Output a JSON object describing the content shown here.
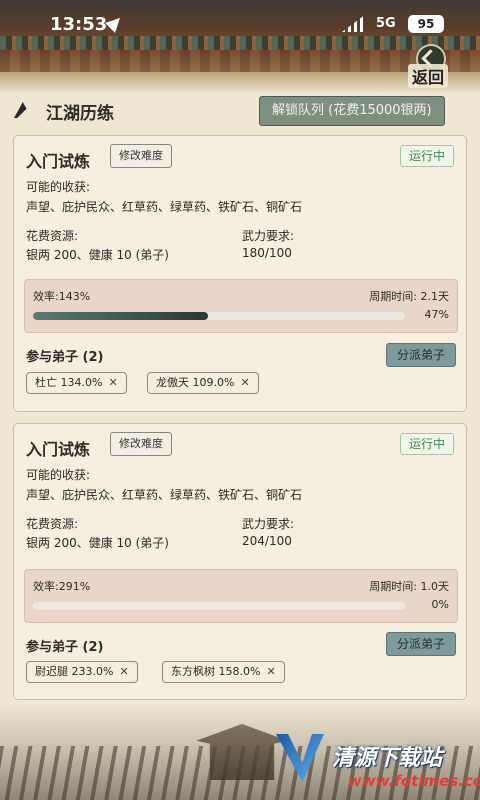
{
  "status_bar": {
    "time": "13:53",
    "network": "5G",
    "battery": "95"
  },
  "back_button": {
    "label": "返回"
  },
  "header": {
    "title": "江湖历练",
    "unlock_button": "解锁队列 (花费15000银两)"
  },
  "cards": [
    {
      "title": "入门试炼",
      "edit_button": "修改难度",
      "status": "运行中",
      "possible_gains_label": "可能的收获:",
      "possible_gains": "声望、庇护民众、红草药、绿草药、铁矿石、铜矿石",
      "cost_label": "花费资源:",
      "cost_value": "银两 200、健康 10 (弟子)",
      "force_label": "武力要求:",
      "force_value": "180/100",
      "efficiency": "效率:143%",
      "cycle": "周期时间: 2.1天",
      "progress": 0.47,
      "progress_text": "47%",
      "participants_label": "参与弟子 (2)",
      "dispatch_button": "分派弟子",
      "disciples": [
        {
          "label": "杜亡 134.0%",
          "close": "✕"
        },
        {
          "label": "龙傲天 109.0%",
          "close": "✕"
        }
      ]
    },
    {
      "title": "入门试炼",
      "edit_button": "修改难度",
      "status": "运行中",
      "possible_gains_label": "可能的收获:",
      "possible_gains": "声望、庇护民众、红草药、绿草药、铁矿石、铜矿石",
      "cost_label": "花费资源:",
      "cost_value": "银两 200、健康 10 (弟子)",
      "force_label": "武力要求:",
      "force_value": "204/100",
      "efficiency": "效率:291%",
      "cycle": "周期时间: 1.0天",
      "progress": 0.0,
      "progress_text": "0%",
      "participants_label": "参与弟子 (2)",
      "dispatch_button": "分派弟子",
      "disciples": [
        {
          "label": "尉迟腿 233.0%",
          "close": "✕"
        },
        {
          "label": "东方枫树 158.0%",
          "close": "✕"
        }
      ]
    }
  ],
  "watermark": {
    "title": "清源下载站",
    "url": "www.fotimes.com"
  },
  "colors": {
    "background": "#f0e7d3",
    "accent_green": "#4b8a4f",
    "progress_dark": "#243b37",
    "dispatch_button": "#7f9a9d"
  }
}
